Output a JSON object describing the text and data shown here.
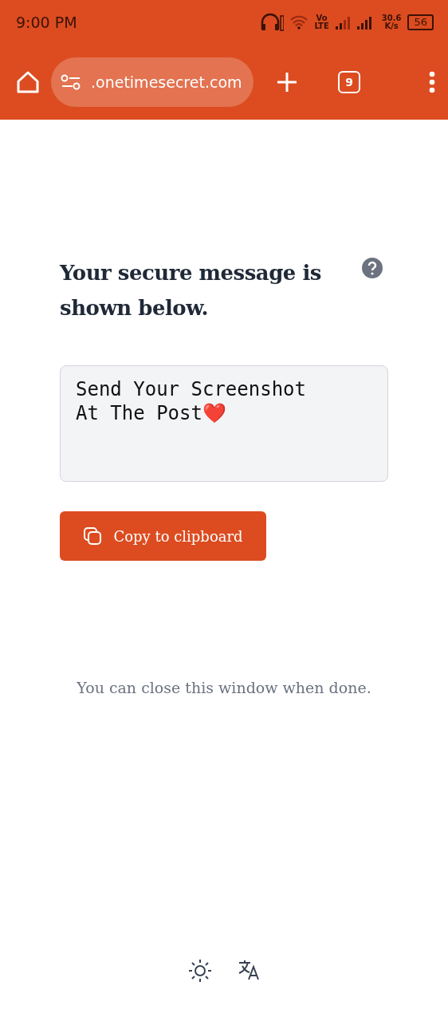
{
  "status_bar": {
    "time": "9:00 PM",
    "network_top": "Vo",
    "network_bottom": "LTE",
    "speed_value": "30.6",
    "speed_unit": "K/s",
    "battery": "56"
  },
  "browser_toolbar": {
    "url": ".onetimesecret.com",
    "tab_count": "9"
  },
  "page": {
    "heading": "Your secure message is shown below.",
    "message": "Send Your Screenshot\nAt The Post❤️",
    "copy_button": "Copy to clipboard",
    "note": "You can close this window when done."
  }
}
